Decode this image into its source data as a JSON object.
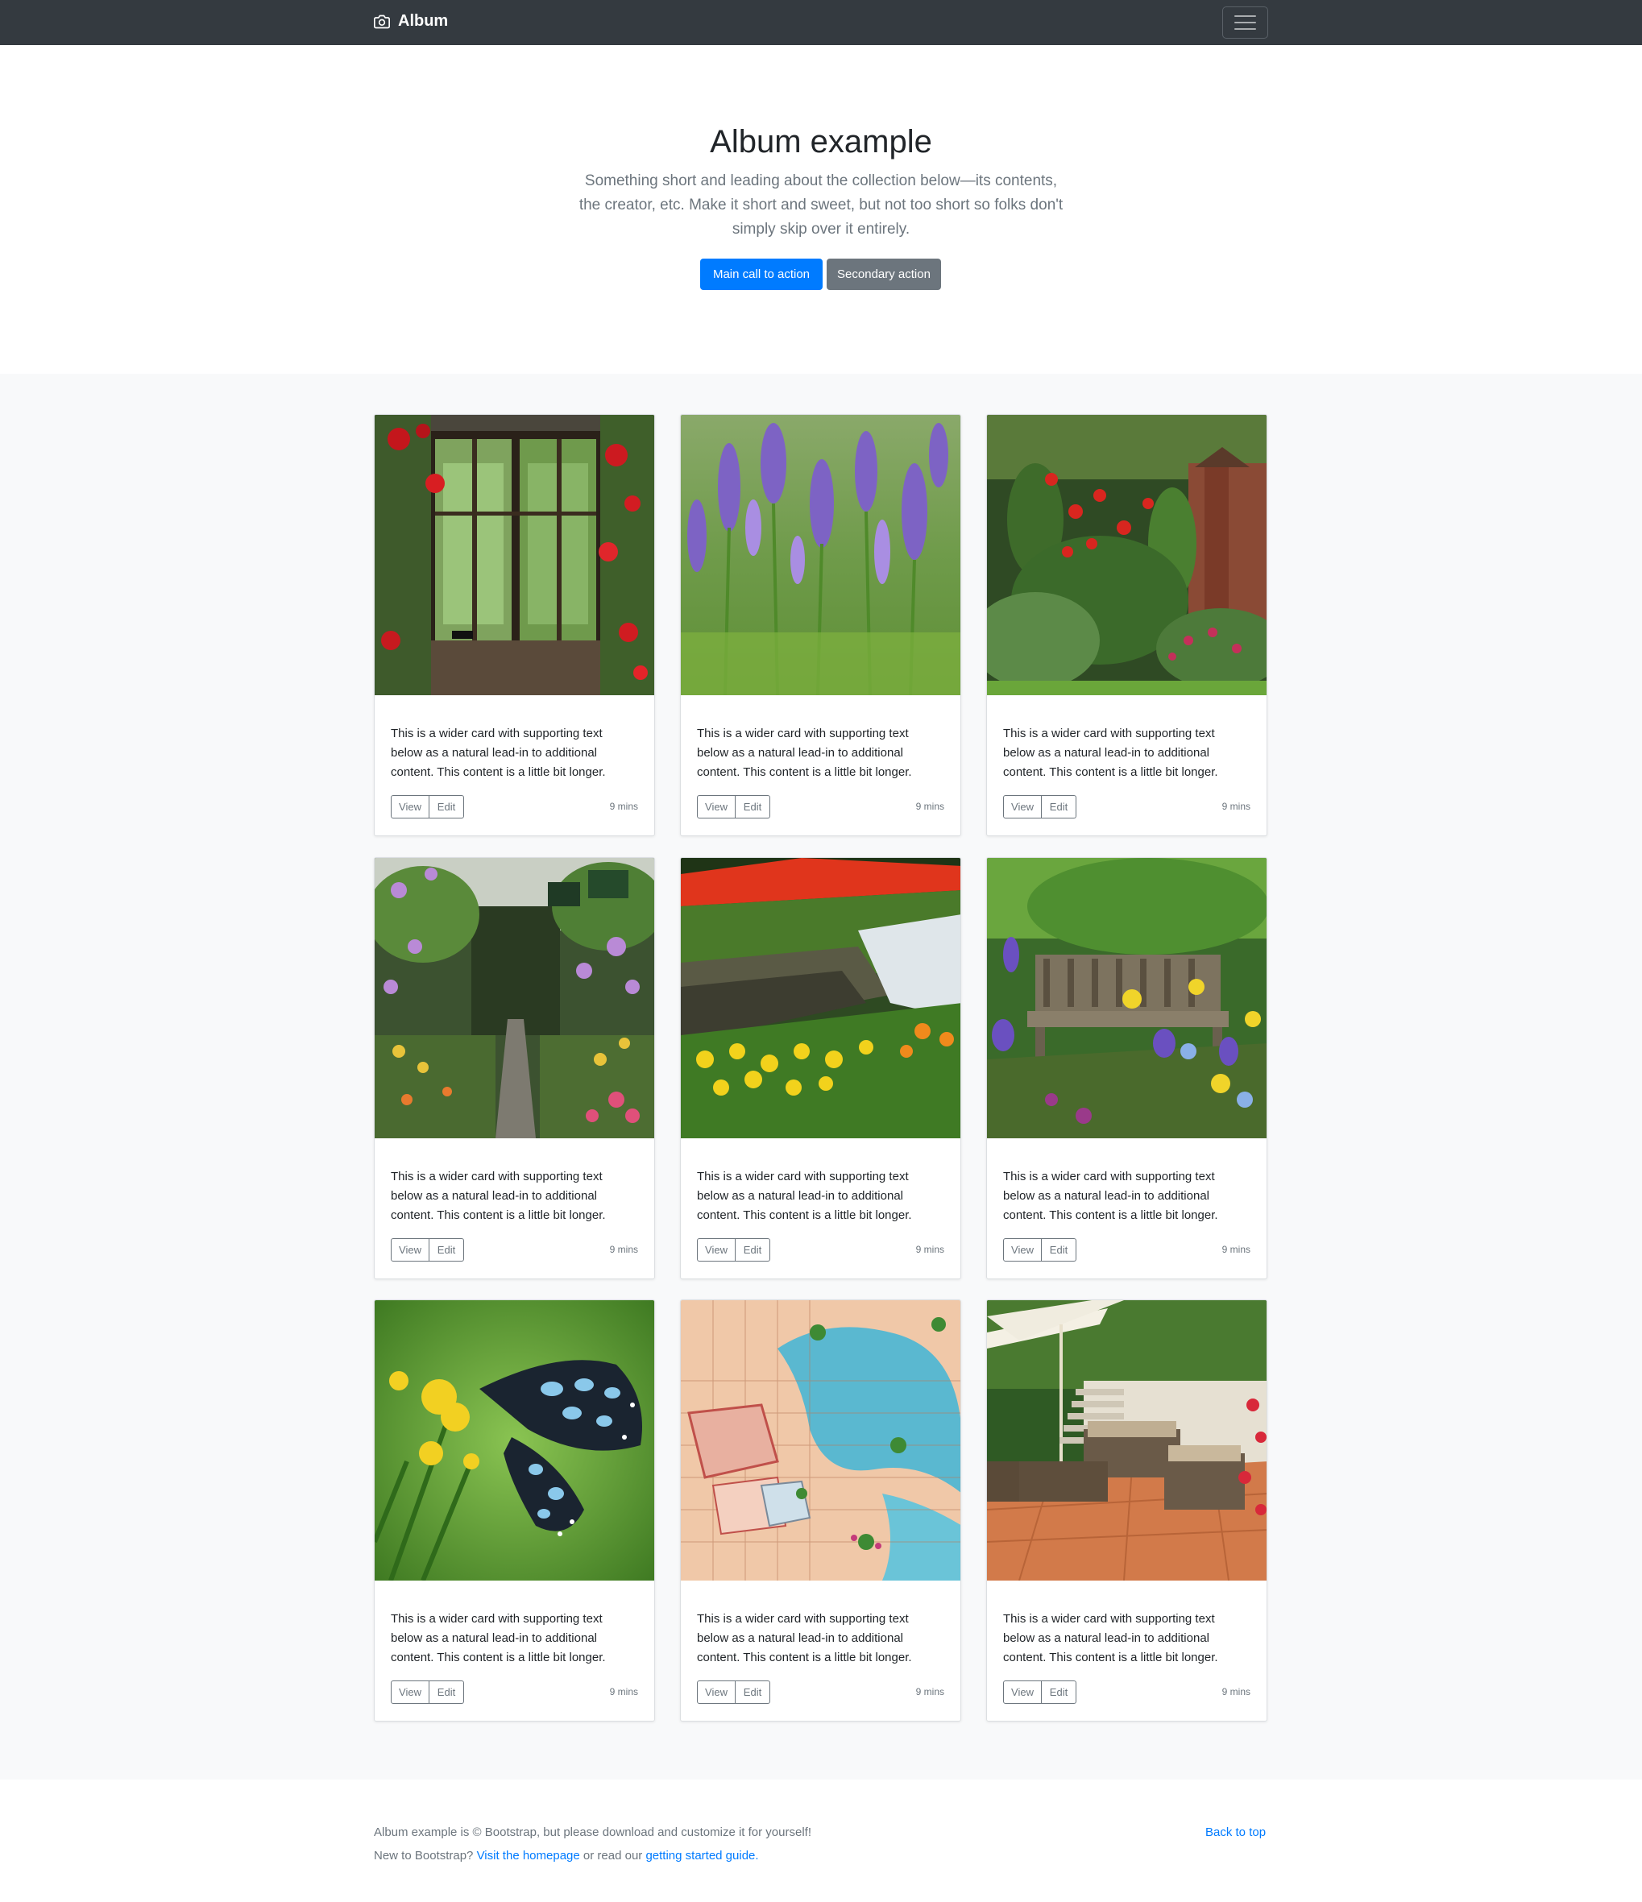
{
  "navbar": {
    "brand": "Album",
    "camera_icon": "camera-icon",
    "toggler_icon": "hamburger-menu-icon"
  },
  "jumbotron": {
    "title": "Album example",
    "lead": "Something short and leading about the collection below—its contents, the creator, etc. Make it short and sweet, but not too short so folks don't simply skip over it entirely.",
    "primary_button": "Main call to action",
    "secondary_button": "Secondary action"
  },
  "cards": [
    {
      "image": "greenhouse door with red geraniums",
      "text": "This is a wider card with supporting text below as a natural lead-in to additional content. This content is a little bit longer.",
      "view": "View",
      "edit": "Edit",
      "time": "9 mins"
    },
    {
      "image": "purple lavender flowers",
      "text": "This is a wider card with supporting text below as a natural lead-in to additional content. This content is a little bit longer.",
      "view": "View",
      "edit": "Edit",
      "time": "9 mins"
    },
    {
      "image": "garden with red flowers and brick wall",
      "text": "This is a wider card with supporting text below as a natural lead-in to additional content. This content is a little bit longer.",
      "view": "View",
      "edit": "Edit",
      "time": "9 mins"
    },
    {
      "image": "greenhouse with hanging baskets",
      "text": "This is a wider card with supporting text below as a natural lead-in to additional content. This content is a little bit longer.",
      "view": "View",
      "edit": "Edit",
      "time": "9 mins"
    },
    {
      "image": "canal with yellow daffodils",
      "text": "This is a wider card with supporting text below as a natural lead-in to additional content. This content is a little bit longer.",
      "view": "View",
      "edit": "Edit",
      "time": "9 mins"
    },
    {
      "image": "wooden bench with irises",
      "text": "This is a wider card with supporting text below as a natural lead-in to additional content. This content is a little bit longer.",
      "view": "View",
      "edit": "Edit",
      "time": "9 mins"
    },
    {
      "image": "butterfly on yellow flower",
      "text": "This is a wider card with supporting text below as a natural lead-in to additional content. This content is a little bit longer.",
      "view": "View",
      "edit": "Edit",
      "time": "9 mins"
    },
    {
      "image": "garden pool plan sketch",
      "text": "This is a wider card with supporting text below as a natural lead-in to additional content. This content is a little bit longer.",
      "view": "View",
      "edit": "Edit",
      "time": "9 mins"
    },
    {
      "image": "patio with umbrella and wicker sofas",
      "text": "This is a wider card with supporting text below as a natural lead-in to additional content. This content is a little bit longer.",
      "view": "View",
      "edit": "Edit",
      "time": "9 mins"
    }
  ],
  "footer": {
    "line1": "Album example is © Bootstrap, but please download and customize it for yourself!",
    "line2_prefix": "New to Bootstrap?",
    "line2_link1": "Visit the homepage",
    "line2_middle": "or read our",
    "line2_link2": "getting started guide.",
    "back_to_top": "Back to top"
  }
}
